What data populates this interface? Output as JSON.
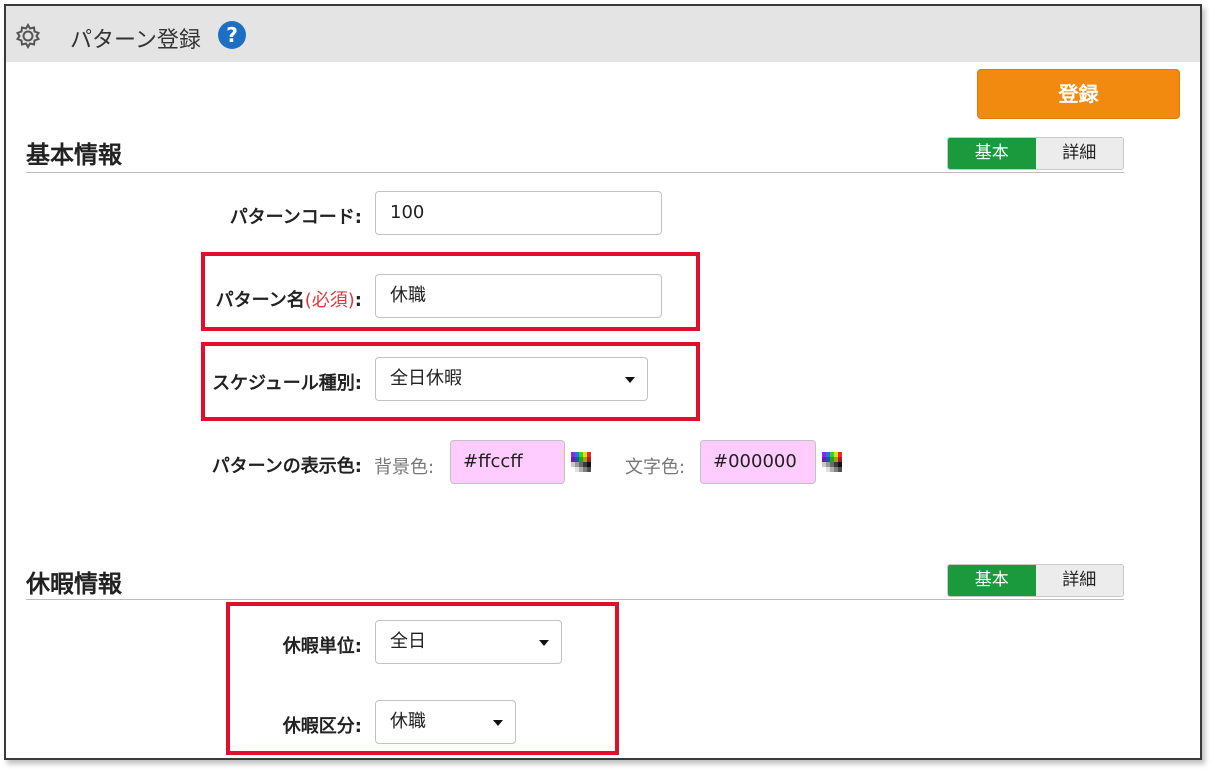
{
  "header": {
    "title": "パターン登録",
    "help_glyph": "?"
  },
  "actions": {
    "register_label": "登録"
  },
  "basic_info": {
    "title": "基本情報",
    "toggle": {
      "basic": "基本",
      "detail": "詳細",
      "selected": "基本"
    },
    "pattern_code": {
      "label": "パターンコード:",
      "value": "100"
    },
    "pattern_name": {
      "label_main": "パターン名",
      "label_required": "(必須)",
      "label_colon": ":",
      "value": "休職"
    },
    "schedule_type": {
      "label": "スケジュール種別:",
      "value": "全日休暇"
    },
    "display_color": {
      "label": "パターンの表示色:",
      "bg_label": "背景色:",
      "bg_value": "#ffccff",
      "text_label": "文字色:",
      "text_value": "#000000"
    }
  },
  "leave_info": {
    "title": "休暇情報",
    "toggle": {
      "basic": "基本",
      "detail": "詳細",
      "selected": "基本"
    },
    "unit": {
      "label": "休暇単位:",
      "value": "全日"
    },
    "category": {
      "label": "休暇区分:",
      "value": "休職"
    }
  },
  "colors": {
    "accent_orange": "#f28a10",
    "toggle_green": "#1a9a3c",
    "highlight_red": "#e0102a",
    "pattern_bg": "#ffccff"
  }
}
